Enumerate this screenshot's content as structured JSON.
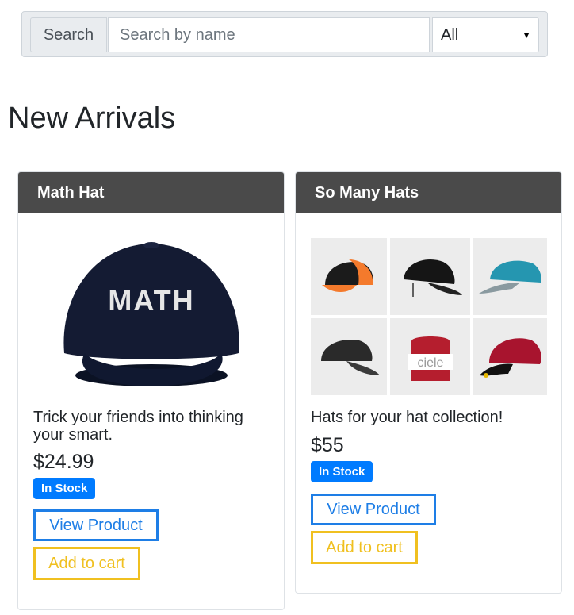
{
  "search": {
    "button_label": "Search",
    "placeholder": "Search by name",
    "filter_value": "All"
  },
  "page_title": "New Arrivals",
  "products": [
    {
      "title": "Math Hat",
      "image_text": "MATH",
      "description": "Trick your friends into thinking your smart.",
      "price": "$24.99",
      "stock": "In Stock",
      "view_label": "View Product",
      "cart_label": "Add to cart"
    },
    {
      "title": "So Many Hats",
      "image_text": "ciele",
      "description": "Hats for your hat collection!",
      "price": "$55",
      "stock": "In Stock",
      "view_label": "View Product",
      "cart_label": "Add to cart"
    }
  ],
  "colors": {
    "header_bg": "#4a4a4a",
    "badge": "#007bff",
    "view_button": "#1e7ee6",
    "cart_button": "#f0c020"
  }
}
